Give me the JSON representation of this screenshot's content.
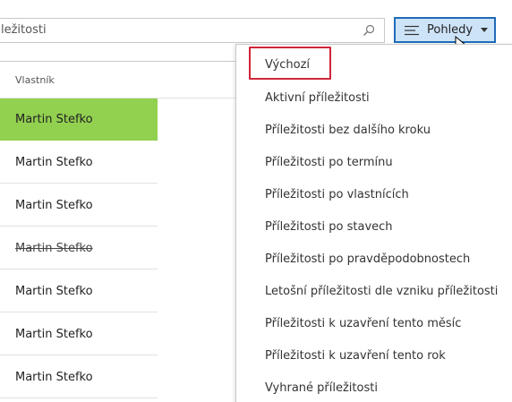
{
  "search": {
    "value": "ležitosti"
  },
  "views_button": {
    "label": "Pohledy",
    "icon": "hamburger-icon"
  },
  "grid": {
    "column_header": "Vlastník",
    "rows": [
      {
        "owner": "Martin Stefko",
        "selected": true
      },
      {
        "owner": "Martin Stefko"
      },
      {
        "owner": "Martin Stefko"
      },
      {
        "owner": "Martin Stefko",
        "struck": true
      },
      {
        "owner": "Martin Stefko"
      },
      {
        "owner": "Martin Stefko"
      },
      {
        "owner": "Martin Stefko"
      }
    ],
    "selected_color": "#92d050"
  },
  "views_menu": {
    "items": [
      "Výchozí",
      "Aktivní příležitosti",
      "Příležitosti bez dalšího kroku",
      "Příležitosti po termínu",
      "Příležitosti po vlastnících",
      "Příležitosti po stavech",
      "Příležitosti po pravděpodobnostech",
      "Letošní příležitosti dle vzniku příležitosti",
      "Příležitosti k uzavření tento měsíc",
      "Příležitosti k uzavření tento rok",
      "Vyhrané příležitosti"
    ],
    "highlight_color": "#d0243a"
  },
  "accent_color": "#1e6bb8"
}
